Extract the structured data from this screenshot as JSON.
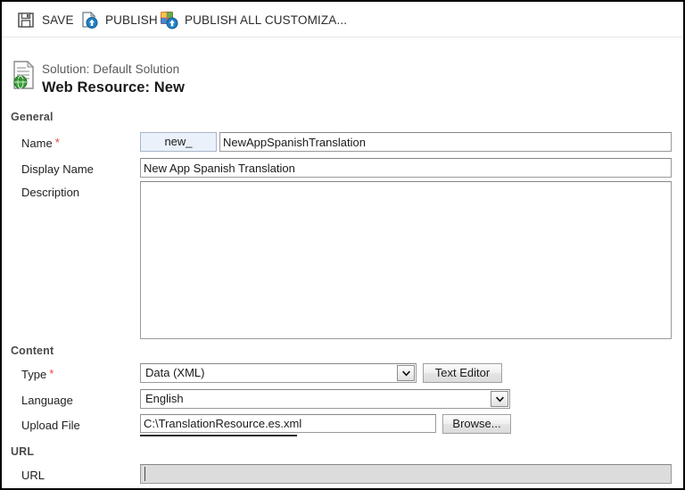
{
  "commandbar": {
    "buttons": [
      {
        "label": "SAVE",
        "icon": "save-floppy-icon"
      },
      {
        "label": "PUBLISH",
        "icon": "publish-icon"
      },
      {
        "label": "PUBLISH ALL CUSTOMIZA...",
        "icon": "publish-all-customizations-icon"
      }
    ]
  },
  "heading": {
    "icon": "web-resource-document-globe-icon",
    "solution_line": "Solution: Default Solution",
    "record_title": "Web Resource: New"
  },
  "sections": {
    "general": {
      "header": "General",
      "name": {
        "label": "Name",
        "required_marker": "*",
        "prefix_value": "new_",
        "value": "NewAppSpanishTranslation",
        "placeholder": ""
      },
      "display_name": {
        "label": "Display Name",
        "value": "New App Spanish Translation",
        "placeholder": ""
      },
      "description": {
        "label": "Description",
        "value": "",
        "placeholder": ""
      }
    },
    "content": {
      "header": "Content",
      "type": {
        "label": "Type",
        "required_marker": "*",
        "selected": "Data (XML)",
        "arrow_icon": "chevron-down-icon"
      },
      "text_editor_button": "Text Editor",
      "language": {
        "label": "Language",
        "selected": "English",
        "arrow_icon": "chevron-down-icon"
      },
      "upload_file": {
        "label": "Upload File",
        "value": "C:\\TranslationResource.es.xml",
        "placeholder": "",
        "browse_button": "Browse..."
      }
    },
    "url": {
      "header": "URL",
      "url_field": {
        "label": "URL",
        "value": "",
        "placeholder": ""
      }
    }
  },
  "colors": {
    "required_asterisk": "#e8453c",
    "prefix_fill": "#eaf1fb",
    "disabled_fill": "#dcdcdc",
    "section_header_text": "#4a4a4a",
    "window_border": "#000000"
  }
}
